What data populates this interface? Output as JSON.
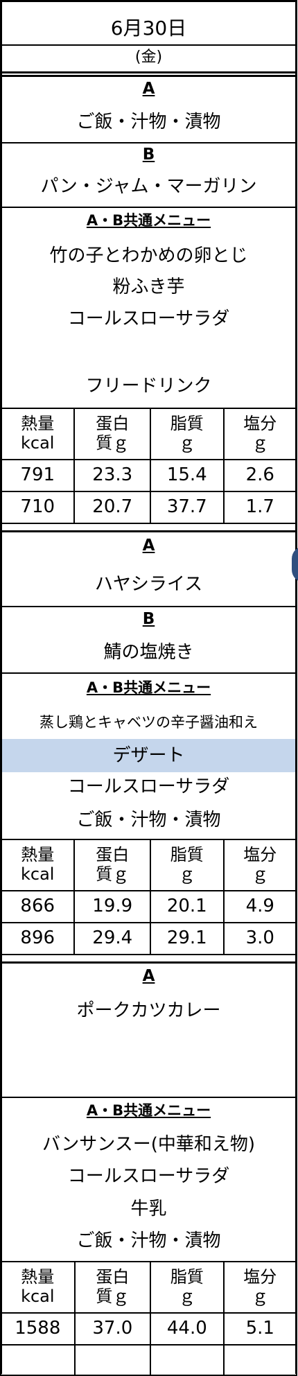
{
  "header": {
    "date": "6月30日",
    "weekday": "(金)"
  },
  "labels": {
    "A": "A",
    "B": "B",
    "common": "A・B共通メニュー"
  },
  "nutrition_headers": {
    "energy": [
      "熱量",
      "kcal"
    ],
    "protein": [
      "蛋白",
      "質ｇ"
    ],
    "fat": [
      "脂質",
      "ｇ"
    ],
    "salt": [
      "塩分",
      "ｇ"
    ]
  },
  "block1": {
    "a_menu": "ご飯・汁物・漬物",
    "b_menu": "パン・ジャム・マーガリン",
    "common_items": [
      "竹の子とわかめの卵とじ",
      "粉ふき芋",
      "コールスローサラダ",
      "",
      "フリードリンク"
    ],
    "nutrition": [
      [
        "791",
        "23.3",
        "15.4",
        "2.6"
      ],
      [
        "710",
        "20.7",
        "37.7",
        "1.7"
      ]
    ]
  },
  "block2": {
    "a_menu": "ハヤシライス",
    "b_menu": "鯖の塩焼き",
    "common_items": [
      "蒸し鶏とキャベツの辛子醤油和え",
      "デザート",
      "コールスローサラダ",
      "ご飯・汁物・漬物"
    ],
    "highlight_color": "#c5d6ec",
    "nutrition": [
      [
        "866",
        "19.9",
        "20.1",
        "4.9"
      ],
      [
        "896",
        "29.4",
        "29.1",
        "3.0"
      ]
    ]
  },
  "block3": {
    "a_menu": "ポークカツカレー",
    "common_items": [
      "バンサンスー(中華和え物)",
      "コールスローサラダ",
      "牛乳",
      "ご飯・汁物・漬物"
    ],
    "nutrition": [
      [
        "1588",
        "37.0",
        "44.0",
        "5.1"
      ]
    ]
  }
}
